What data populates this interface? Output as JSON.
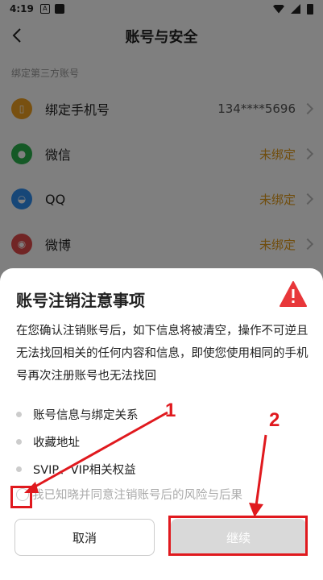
{
  "status_bar": {
    "time": "4:19",
    "app_icon": "A"
  },
  "header": {
    "title": "账号与安全"
  },
  "section": {
    "title": "绑定第三方账号"
  },
  "rows": [
    {
      "label": "绑定手机号",
      "value": "134****5696",
      "icon": "phone-icon",
      "color": "#f0a020"
    },
    {
      "label": "微信",
      "value": "未绑定",
      "icon": "wechat-icon",
      "color": "#2bb24c"
    },
    {
      "label": "QQ",
      "value": "未绑定",
      "icon": "qq-icon",
      "color": "#2f8ff0"
    },
    {
      "label": "微博",
      "value": "未绑定",
      "icon": "weibo-icon",
      "color": "#e24b4b"
    }
  ],
  "dialog": {
    "title": "账号注销注意事项",
    "description": "在您确认注销账号后，如下信息将被清空，操作不可逆且无法找回相关的任何内容和信息，即使您使用相同的手机号再次注册账号也无法找回",
    "bullets": [
      "账号信息与绑定关系",
      "收藏地址",
      "SVIP、VIP相关权益"
    ],
    "agree_text": "我已知晓并同意注销账号后的风险与后果",
    "cancel_label": "取消",
    "continue_label": "继续"
  },
  "annotations": {
    "label_1": "1",
    "label_2": "2",
    "color": "#e0191e"
  }
}
